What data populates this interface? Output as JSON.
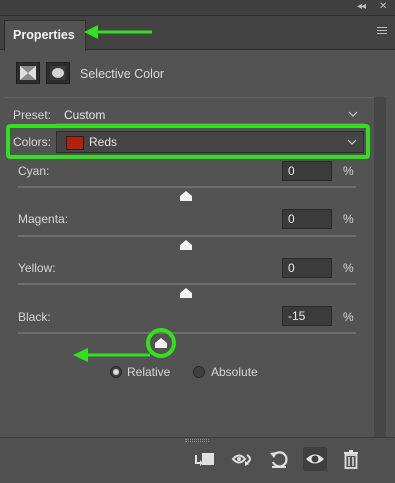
{
  "window": {
    "collapse_label": "◂◂",
    "close_label": "✕"
  },
  "panel": {
    "tab_label": "Properties",
    "menu_icon": "hamburger-menu-icon"
  },
  "header": {
    "title": "Selective Color",
    "icons": [
      "layer-mask-icon",
      "circle-mask-icon"
    ]
  },
  "preset": {
    "label": "Preset:",
    "value": "Custom"
  },
  "colors": {
    "label": "Colors:",
    "value": "Reds",
    "swatch_color": "#b51f0c"
  },
  "sliders": [
    {
      "label": "Cyan:",
      "value": "0",
      "unit": "%",
      "level": 0
    },
    {
      "label": "Magenta:",
      "value": "0",
      "unit": "%",
      "level": 0
    },
    {
      "label": "Yellow:",
      "value": "0",
      "unit": "%",
      "level": 0
    },
    {
      "label": "Black:",
      "value": "-15",
      "unit": "%",
      "level": -15
    }
  ],
  "method": {
    "options": [
      "Relative",
      "Absolute"
    ],
    "selected": "Relative"
  },
  "footer": {
    "buttons": [
      "clip-to-layer-icon",
      "view-previous-state-icon",
      "reset-icon",
      "visibility-eye-icon",
      "delete-trash-icon"
    ]
  },
  "annotation_color": "#33e01d"
}
